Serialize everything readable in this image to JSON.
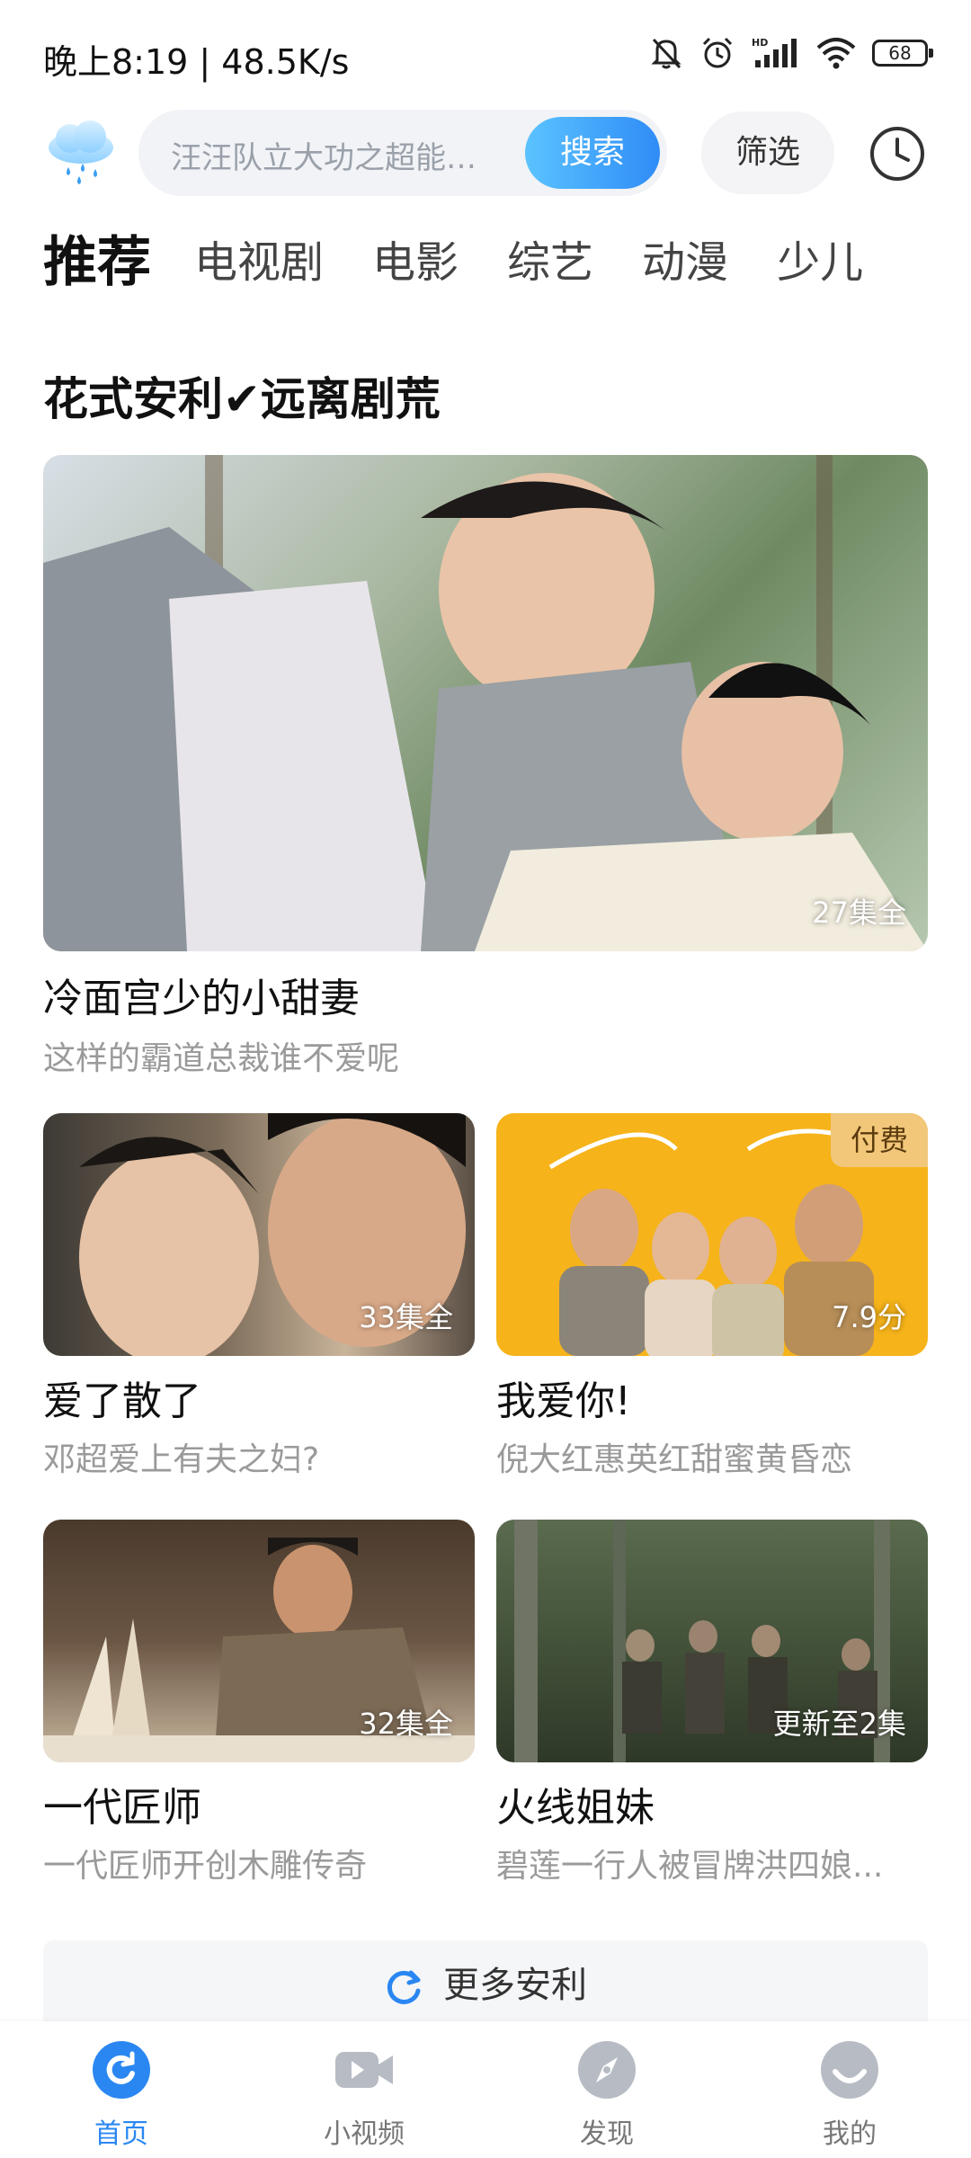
{
  "status_bar": {
    "time": "晚上8:19 | 48.5K/s",
    "battery": "68",
    "icons": [
      "mute-bell-icon",
      "alarm-icon",
      "hd-signal-icon",
      "wifi-icon",
      "battery-icon"
    ]
  },
  "search": {
    "placeholder": "汪汪队立大功之超能救援",
    "button_label": "搜索",
    "filter_label": "筛选"
  },
  "tabs": [
    {
      "label": "推荐",
      "active": true
    },
    {
      "label": "电视剧"
    },
    {
      "label": "电影"
    },
    {
      "label": "综艺"
    },
    {
      "label": "动漫"
    },
    {
      "label": "少儿"
    }
  ],
  "section": {
    "title": "花式安利✔远离剧荒",
    "featured": {
      "badge": "27集全",
      "title": "冷面宫少的小甜妻",
      "subtitle": "这样的霸道总裁谁不爱呢"
    },
    "items": [
      {
        "badge": "33集全",
        "title": "爱了散了",
        "subtitle": "邓超爱上有夫之妇?"
      },
      {
        "badge": "7.9分",
        "tag": "付费",
        "title": "我爱你!",
        "subtitle": "倪大红惠英红甜蜜黄昏恋"
      },
      {
        "badge": "32集全",
        "title": "一代匠师",
        "subtitle": "一代匠师开创木雕传奇"
      },
      {
        "badge": "更新至2集",
        "title": "火线姐妹",
        "subtitle": "碧莲一行人被冒牌洪四娘..."
      }
    ],
    "more_label": "更多安利"
  },
  "bottom_nav": [
    {
      "label": "首页",
      "icon": "home-icon",
      "active": true
    },
    {
      "label": "小视频",
      "icon": "video-camera-icon"
    },
    {
      "label": "发现",
      "icon": "compass-icon"
    },
    {
      "label": "我的",
      "icon": "profile-icon"
    }
  ],
  "colors": {
    "accent": "#2a87f2",
    "search_button_start": "#5bc3ff",
    "search_button_end": "#2f8cf7",
    "paid_tag": "#f2c77a"
  }
}
